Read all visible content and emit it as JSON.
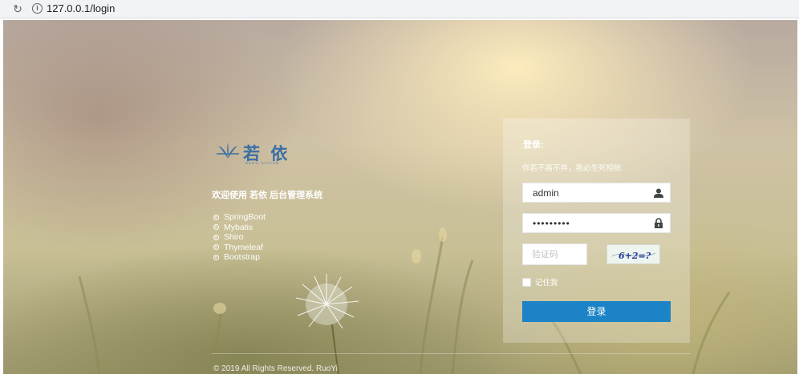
{
  "browser": {
    "url": "127.0.0.1/login"
  },
  "brand": {
    "logo_text": "若 依",
    "logo_sub": "RUOYI SYSTEM",
    "welcome": "欢迎使用 若依 后台管理系统",
    "tech": [
      "SpringBoot",
      "Mybatis",
      "Shiro",
      "Thymeleaf",
      "Bootstrap"
    ]
  },
  "login": {
    "title": "登录:",
    "tip": "你若不离不弃，我必生死相依",
    "username": "admin",
    "password": "•••••••••",
    "captcha_placeholder": "验证码",
    "captcha_text": "6+2=?",
    "remember_label": "记住我",
    "submit_label": "登录"
  },
  "footer": {
    "copyright": "© 2019 All Rights Reserved. RuoYi"
  },
  "colors": {
    "accent": "#1c84c6",
    "logo": "#3a6ea5"
  }
}
